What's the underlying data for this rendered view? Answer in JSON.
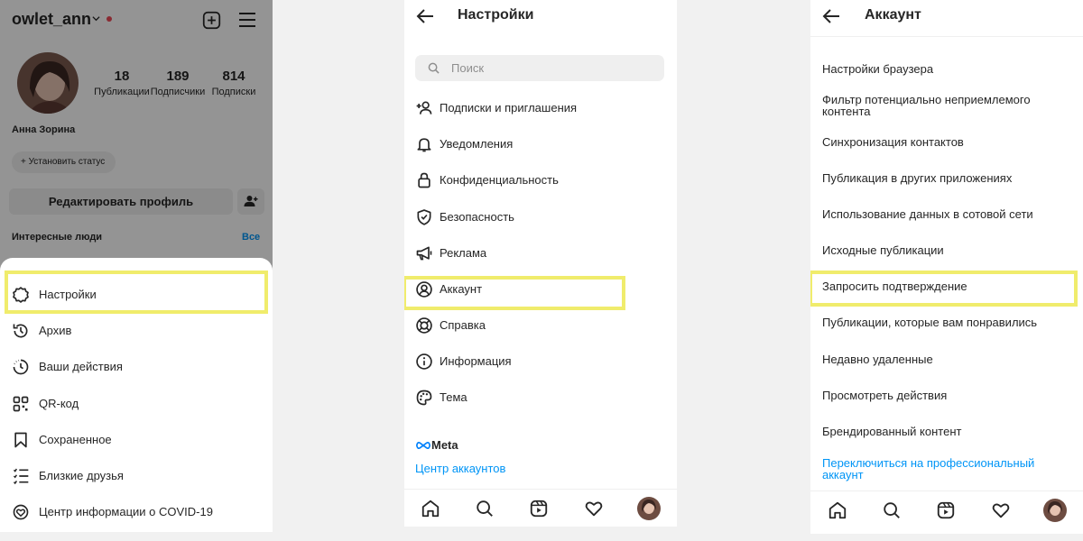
{
  "profile_panel": {
    "username": "owlet_ann",
    "stats": [
      {
        "value": "18",
        "label": "Публикации"
      },
      {
        "value": "189",
        "label": "Подписчики"
      },
      {
        "value": "814",
        "label": "Подписки"
      }
    ],
    "full_name": "Анна Зорина",
    "set_status_label": "Установить статус",
    "edit_profile_label": "Редактировать профиль",
    "interesting_people_label": "Интересные люди",
    "see_all_label": "Все",
    "menu": [
      {
        "label": "Настройки",
        "icon": "settings-icon"
      },
      {
        "label": "Архив",
        "icon": "archive-icon"
      },
      {
        "label": "Ваши действия",
        "icon": "activity-icon"
      },
      {
        "label": "QR-код",
        "icon": "qr-code-icon"
      },
      {
        "label": "Сохраненное",
        "icon": "bookmark-icon"
      },
      {
        "label": "Близкие друзья",
        "icon": "close-friends-icon"
      },
      {
        "label": "Центр информации о COVID-19",
        "icon": "covid-info-icon"
      }
    ]
  },
  "settings_panel": {
    "title": "Настройки",
    "search_placeholder": "Поиск",
    "items": [
      {
        "label": "Подписки и приглашения",
        "icon": "follow-invite-icon"
      },
      {
        "label": "Уведомления",
        "icon": "bell-icon"
      },
      {
        "label": "Конфиденциальность",
        "icon": "lock-icon"
      },
      {
        "label": "Безопасность",
        "icon": "shield-icon"
      },
      {
        "label": "Реклама",
        "icon": "megaphone-icon"
      },
      {
        "label": "Аккаунт",
        "icon": "account-icon"
      },
      {
        "label": "Справка",
        "icon": "lifebuoy-icon"
      },
      {
        "label": "Информация",
        "icon": "info-icon"
      },
      {
        "label": "Тема",
        "icon": "palette-icon"
      }
    ],
    "meta_label": "Meta",
    "accounts_center_label": "Центр аккаунтов"
  },
  "account_panel": {
    "title": "Аккаунт",
    "items": [
      {
        "label": "Настройки браузера"
      },
      {
        "label": "Фильтр потенциально неприемлемого контента"
      },
      {
        "label": "Синхронизация контактов"
      },
      {
        "label": "Публикация в других приложениях"
      },
      {
        "label": "Использование данных в сотовой сети"
      },
      {
        "label": "Исходные публикации"
      },
      {
        "label": "Запросить подтверждение"
      },
      {
        "label": "Публикации, которые вам понравились"
      },
      {
        "label": "Недавно удаленные"
      },
      {
        "label": "Просмотреть действия"
      },
      {
        "label": "Брендированный контент"
      },
      {
        "label": "Переключиться на профессиональный аккаунт"
      }
    ]
  },
  "bottom_nav": [
    "home-icon",
    "search-icon",
    "reels-icon",
    "heart-icon",
    "profile-avatar"
  ],
  "colors": {
    "accent_link": "#0095f6",
    "highlight": "#f0ec6c",
    "notification_dot": "#ed4956"
  }
}
